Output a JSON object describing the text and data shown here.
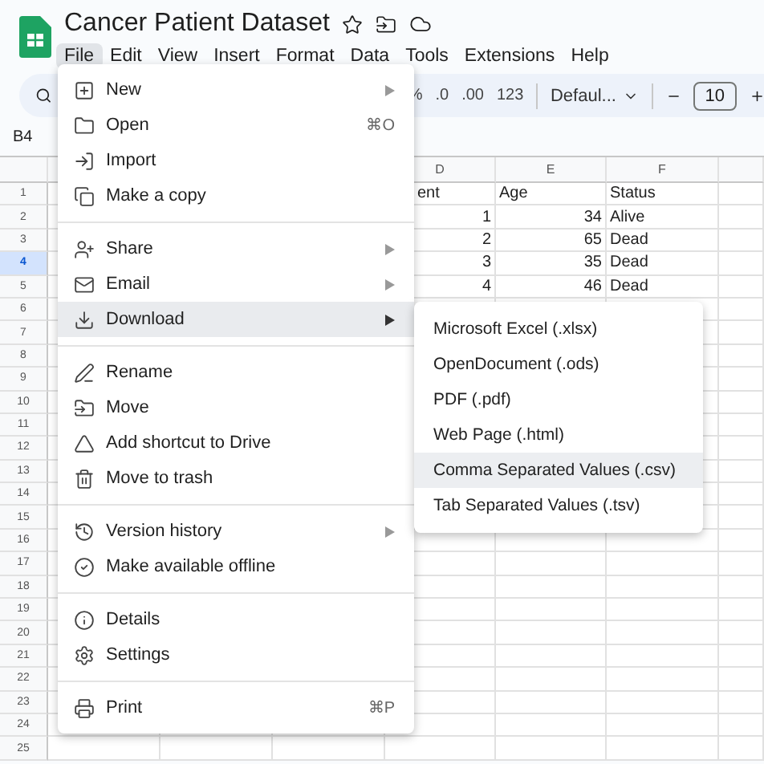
{
  "document": {
    "title": "Cancer Patient Dataset"
  },
  "menu_bar": [
    {
      "label": "File",
      "selected": true
    },
    {
      "label": "Edit",
      "selected": false
    },
    {
      "label": "View",
      "selected": false
    },
    {
      "label": "Insert",
      "selected": false
    },
    {
      "label": "Format",
      "selected": false
    },
    {
      "label": "Data",
      "selected": false
    },
    {
      "label": "Tools",
      "selected": false
    },
    {
      "label": "Extensions",
      "selected": false
    },
    {
      "label": "Help",
      "selected": false
    }
  ],
  "toolbar": {
    "items": [
      "%",
      ".0",
      ".00",
      "123"
    ],
    "font": "Defaul...",
    "font_size": "10"
  },
  "name_box": "B4",
  "sheet": {
    "columns": [
      "D",
      "E",
      "F"
    ],
    "rows": [
      {
        "label": "1",
        "selected": false,
        "cells": [
          {
            "kind": "text",
            "text": "ent"
          },
          {
            "kind": "text",
            "text": "Age"
          },
          {
            "kind": "text",
            "text": "Status"
          }
        ]
      },
      {
        "label": "2",
        "selected": false,
        "cells": [
          {
            "kind": "number",
            "text": "1"
          },
          {
            "kind": "number",
            "text": "34"
          },
          {
            "kind": "text",
            "text": "Alive"
          }
        ]
      },
      {
        "label": "3",
        "selected": false,
        "cells": [
          {
            "kind": "number",
            "text": "2"
          },
          {
            "kind": "number",
            "text": "65"
          },
          {
            "kind": "text",
            "text": "Dead"
          }
        ]
      },
      {
        "label": "4",
        "selected": true,
        "cells": [
          {
            "kind": "number",
            "text": "3"
          },
          {
            "kind": "number",
            "text": "35"
          },
          {
            "kind": "text",
            "text": "Dead"
          }
        ]
      },
      {
        "label": "5",
        "selected": false,
        "cells": [
          {
            "kind": "number",
            "text": "4"
          },
          {
            "kind": "number",
            "text": "46"
          },
          {
            "kind": "text",
            "text": "Dead"
          }
        ]
      },
      {
        "label": "6",
        "selected": false
      },
      {
        "label": "7",
        "selected": false
      },
      {
        "label": "8",
        "selected": false
      },
      {
        "label": "9",
        "selected": false
      },
      {
        "label": "10",
        "selected": false
      },
      {
        "label": "11",
        "selected": false
      },
      {
        "label": "12",
        "selected": false
      },
      {
        "label": "13",
        "selected": false
      },
      {
        "label": "14",
        "selected": false
      },
      {
        "label": "15",
        "selected": false
      },
      {
        "label": "16",
        "selected": false
      },
      {
        "label": "17",
        "selected": false
      },
      {
        "label": "18",
        "selected": false
      },
      {
        "label": "19",
        "selected": false
      },
      {
        "label": "20",
        "selected": false
      },
      {
        "label": "21",
        "selected": false
      },
      {
        "label": "22",
        "selected": false
      },
      {
        "label": "23",
        "selected": false
      },
      {
        "label": "24",
        "selected": false
      },
      {
        "label": "25",
        "selected": false
      }
    ]
  },
  "file_menu": {
    "groups": [
      [
        {
          "label": "New",
          "submenu": true,
          "selected": false
        },
        {
          "label": "Open",
          "shortcut": "⌘O",
          "submenu": false,
          "selected": false
        },
        {
          "label": "Import",
          "submenu": false,
          "selected": false
        },
        {
          "label": "Make a copy",
          "submenu": false,
          "selected": false
        }
      ],
      [
        {
          "label": "Share",
          "submenu": true,
          "selected": false
        },
        {
          "label": "Email",
          "submenu": true,
          "selected": false
        },
        {
          "label": "Download",
          "submenu": true,
          "selected": true
        }
      ],
      [
        {
          "label": "Rename",
          "submenu": false,
          "selected": false
        },
        {
          "label": "Move",
          "submenu": false,
          "selected": false
        },
        {
          "label": "Add shortcut to Drive",
          "submenu": false,
          "selected": false
        },
        {
          "label": "Move to trash",
          "submenu": false,
          "selected": false
        }
      ],
      [
        {
          "label": "Version history",
          "submenu": true,
          "selected": false
        },
        {
          "label": "Make available offline",
          "submenu": false,
          "selected": false
        }
      ],
      [
        {
          "label": "Details",
          "submenu": false,
          "selected": false
        },
        {
          "label": "Settings",
          "submenu": false,
          "selected": false
        }
      ],
      [
        {
          "label": "Print",
          "shortcut": "⌘P",
          "submenu": false,
          "selected": false
        }
      ]
    ]
  },
  "download_submenu": [
    {
      "label": "Microsoft Excel (.xlsx)",
      "selected": false
    },
    {
      "label": "OpenDocument (.ods)",
      "selected": false
    },
    {
      "label": "PDF (.pdf)",
      "selected": false
    },
    {
      "label": "Web Page (.html)",
      "selected": false
    },
    {
      "label": "Comma Separated Values (.csv)",
      "selected": true
    },
    {
      "label": "Tab Separated Values (.tsv)",
      "selected": false
    }
  ]
}
